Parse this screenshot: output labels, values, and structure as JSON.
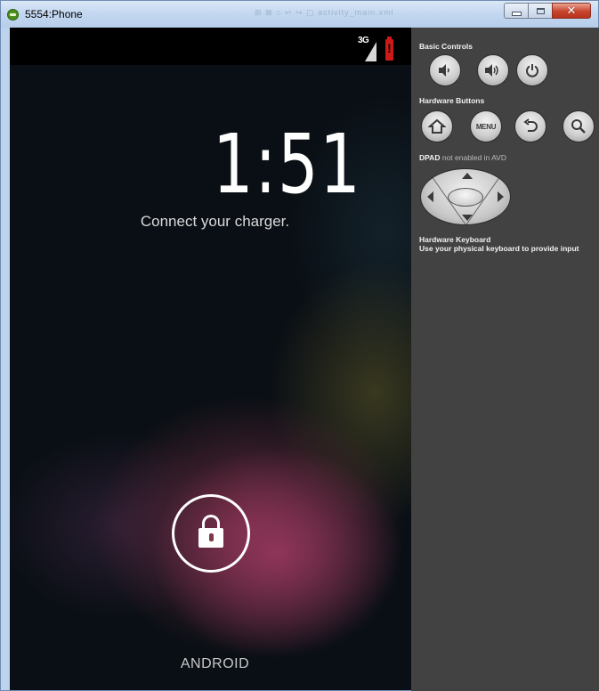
{
  "window": {
    "title": "5554:Phone",
    "ghost_tabs_text": "⊞ ⊠  ⌂ ↩ ↪    ▢ activity_main.xml"
  },
  "phone": {
    "status": {
      "network": "3G",
      "battery_alert": "!"
    },
    "clock": "1:51",
    "charger_message": "Connect your charger.",
    "carrier": "ANDROID"
  },
  "panel": {
    "basic_controls": {
      "label": "Basic Controls",
      "buttons": [
        "volume-down-icon",
        "volume-up-icon",
        "power-icon"
      ]
    },
    "hardware_buttons": {
      "label": "Hardware Buttons",
      "menu_label": "MENU",
      "buttons": [
        "home-icon",
        "menu-button",
        "back-icon",
        "search-icon"
      ]
    },
    "dpad": {
      "label": "DPAD",
      "note": "not enabled in AVD"
    },
    "keyboard": {
      "title": "Hardware Keyboard",
      "description": "Use your physical keyboard to provide input"
    }
  },
  "colors": {
    "panel_bg": "#424242",
    "battery_alert": "#cc1a1a",
    "close_button": "#c8452d"
  }
}
